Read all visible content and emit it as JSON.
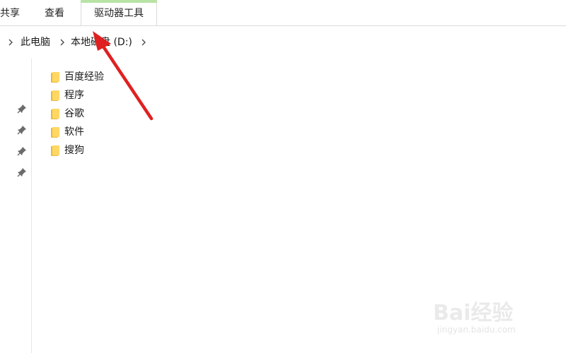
{
  "ribbon": {
    "tabs": [
      {
        "label": "共享"
      },
      {
        "label": "查看"
      },
      {
        "label": "驱动器工具"
      }
    ],
    "active_tab_accent": "#b8e3a5"
  },
  "address": {
    "crumbs": [
      {
        "label": "此电脑"
      },
      {
        "label": "本地磁盘 (D:)"
      }
    ]
  },
  "files": [
    {
      "name": "百度经验",
      "icon": "folder-icon"
    },
    {
      "name": "程序",
      "icon": "folder-icon"
    },
    {
      "name": "谷歌",
      "icon": "folder-icon"
    },
    {
      "name": "软件",
      "icon": "folder-icon"
    },
    {
      "name": "搜狗",
      "icon": "folder-icon"
    }
  ],
  "quick_access_pins": 4,
  "annotation": {
    "arrow_color": "#e02020"
  },
  "watermark": {
    "text": "Bai经验",
    "sub": "jingyan.baidu.com"
  }
}
